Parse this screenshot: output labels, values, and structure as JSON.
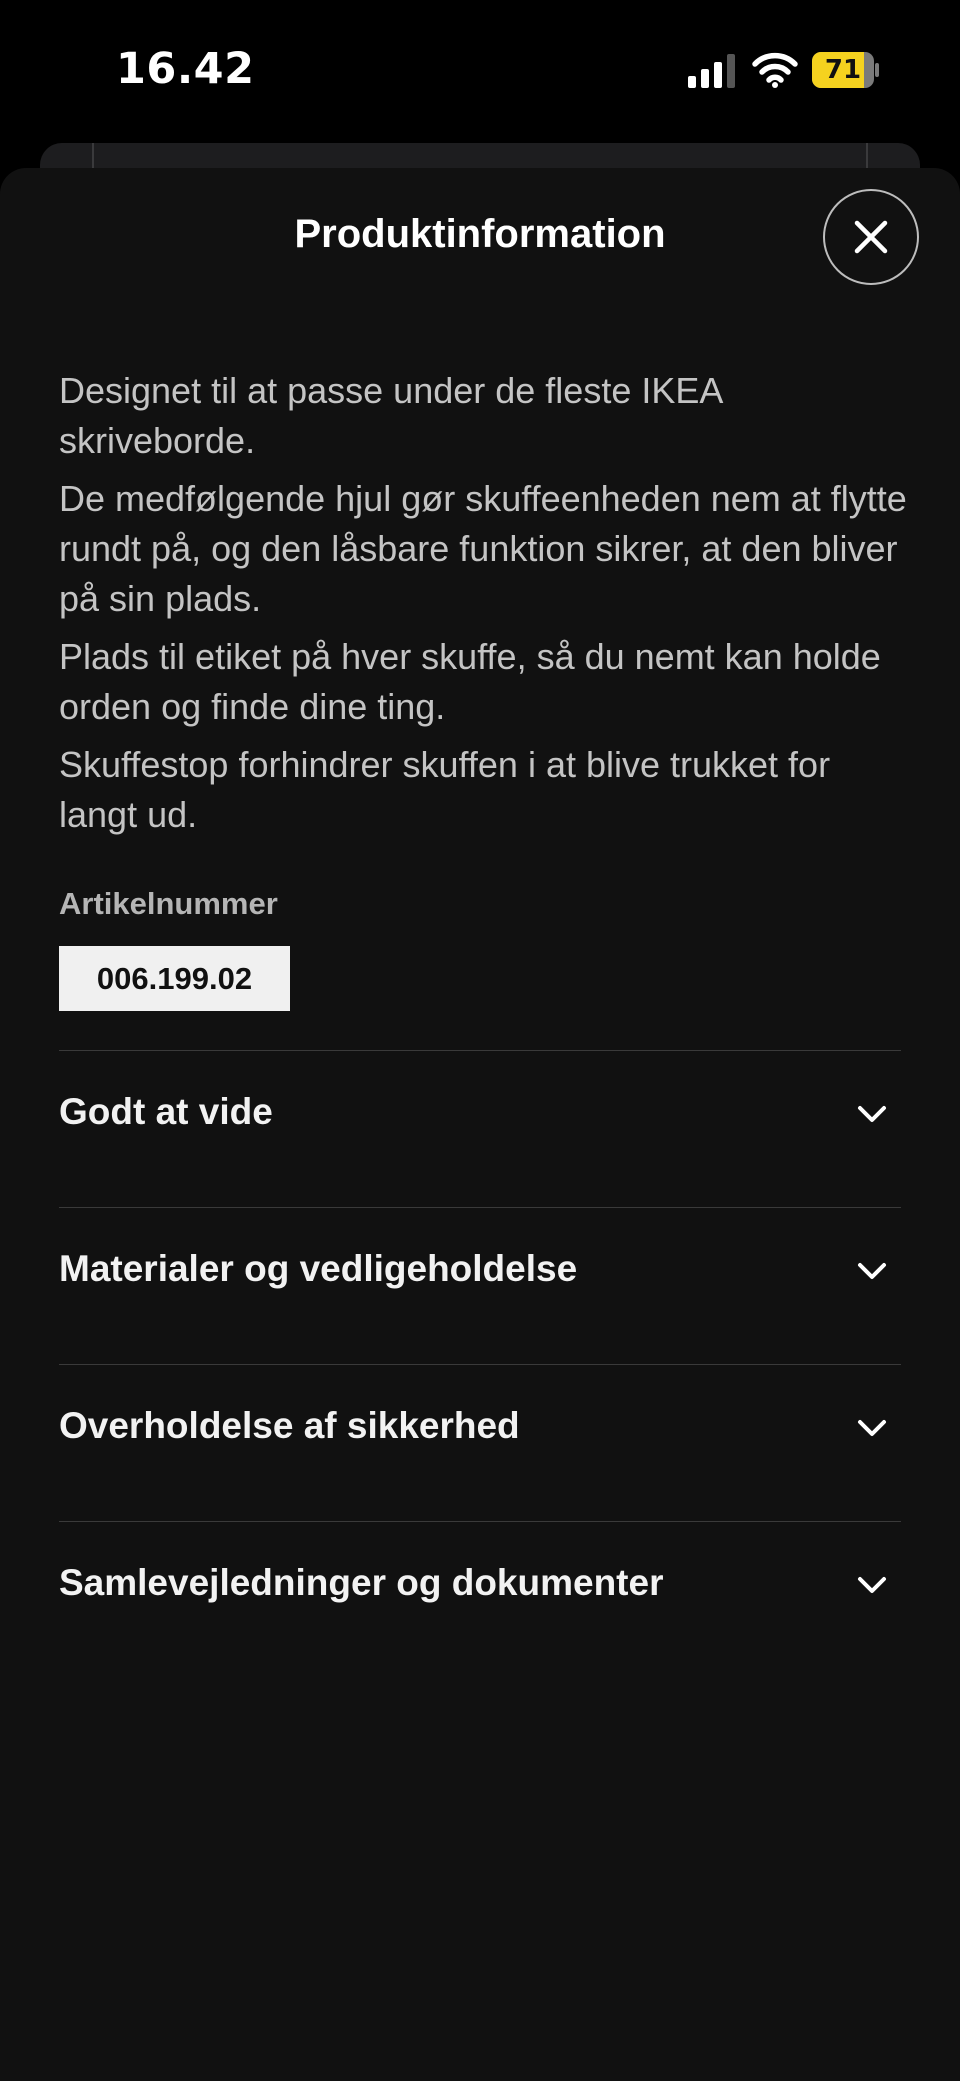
{
  "status_bar": {
    "time": "16.42",
    "battery_level": "71",
    "battery_color": "#f5d21f"
  },
  "sheet": {
    "title": "Produktinformation",
    "close_icon": "close-icon",
    "description": [
      "Designet til at passe under de fleste IKEA skriveborde.",
      "De medfølgende hjul gør skuffeenheden nem at flytte rundt på, og den låsbare funktion sikrer, at den bliver på sin plads.",
      "Plads til etiket på hver skuffe, så du nemt kan holde orden og finde dine ting.",
      "Skuffestop forhindrer skuffen i at blive trukket for langt ud."
    ],
    "article_label": "Artikelnummer",
    "article_number": "006.199.02",
    "sections": [
      {
        "label": "Godt at vide",
        "icon": "chevron-down-icon"
      },
      {
        "label": "Materialer og vedligeholdelse",
        "icon": "chevron-down-icon"
      },
      {
        "label": "Overholdelse af sikkerhed",
        "icon": "chevron-down-icon"
      },
      {
        "label": "Samlevejledninger og dokumenter",
        "icon": "chevron-down-icon"
      }
    ]
  }
}
